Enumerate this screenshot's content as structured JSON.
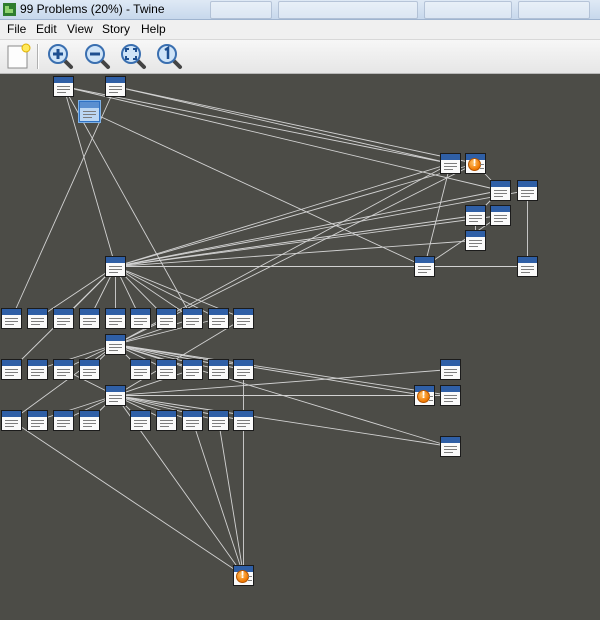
{
  "window": {
    "title": "99 Problems (20%) - Twine"
  },
  "menu": {
    "items": [
      "File",
      "Edit",
      "View",
      "Story",
      "Help"
    ]
  },
  "toolbar": {
    "buttons": [
      {
        "name": "new-passage-button",
        "icon": "new-passage-icon"
      },
      {
        "name": "zoom-in-button",
        "icon": "zoom-in-icon"
      },
      {
        "name": "zoom-out-button",
        "icon": "zoom-out-icon"
      },
      {
        "name": "zoom-fit-button",
        "icon": "zoom-fit-icon"
      },
      {
        "name": "zoom-actual-button",
        "icon": "zoom-actual-icon"
      }
    ]
  },
  "colors": {
    "canvas": "#4c4c47",
    "passage_header": "#2f5fa6",
    "link_line": "#d2d2d2",
    "broken_link_badge": "#f07800",
    "selection": "#bcd7f3"
  },
  "story_map": {
    "passage_count": 54,
    "selected_passages": 1,
    "passages_with_broken_links": 3
  }
}
